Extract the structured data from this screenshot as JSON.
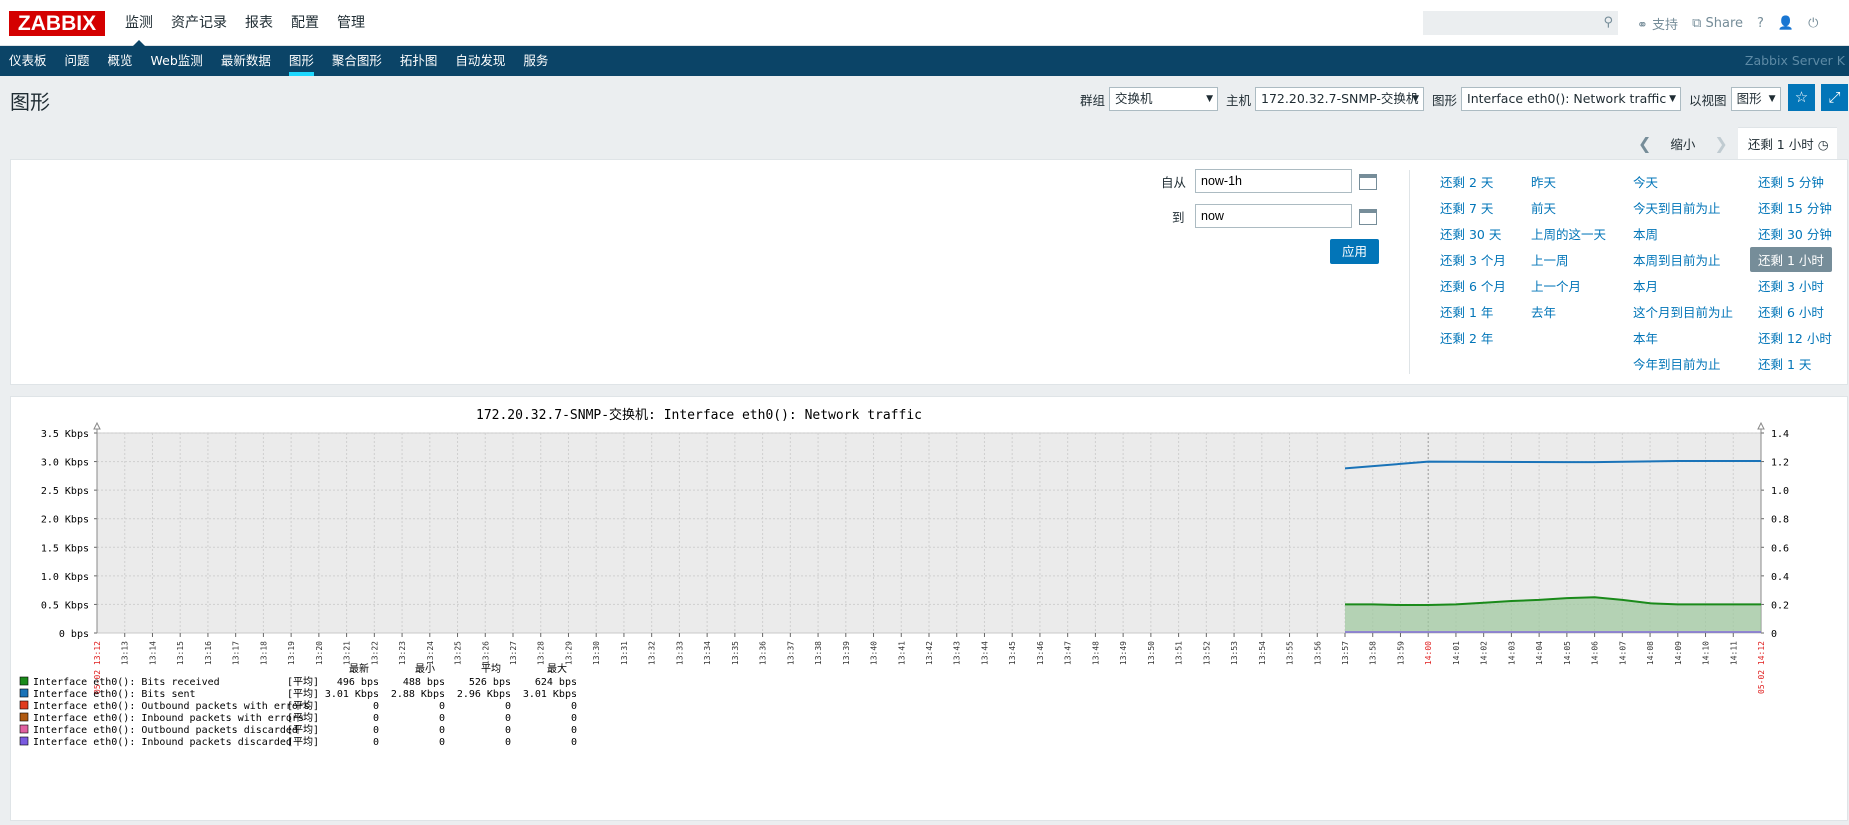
{
  "app": {
    "logo": "ZABBIX",
    "server_name": "Zabbix Server K"
  },
  "main_menu": [
    "监测",
    "资产记录",
    "报表",
    "配置",
    "管理"
  ],
  "top_links": {
    "support": "支持",
    "share": "Share",
    "help": "?",
    "user": "",
    "logout": ""
  },
  "search": {
    "placeholder": "",
    "value": ""
  },
  "sub_menu": [
    "仪表板",
    "问题",
    "概览",
    "Web监测",
    "最新数据",
    "图形",
    "聚合图形",
    "拓扑图",
    "自动发现",
    "服务"
  ],
  "page": {
    "title": "图形"
  },
  "filters": {
    "group_label": "群组",
    "group_value": "交换机",
    "host_label": "主机",
    "host_value": "172.20.32.7-SNMP-交换机",
    "graph_label": "图形",
    "graph_value": "Interface eth0(): Network traffic",
    "view_label": "以视图",
    "view_value": "图形"
  },
  "time_tabs": {
    "zoom_out": "缩小",
    "current": "还剩 1 小时"
  },
  "time_panel": {
    "from_label": "自从",
    "from_value": "now-1h",
    "to_label": "到",
    "to_value": "now",
    "apply": "应用",
    "quick": [
      [
        "还剩 2 天",
        "还剩 7 天",
        "还剩 30 天",
        "还剩 3 个月",
        "还剩 6 个月",
        "还剩 1 年",
        "还剩 2 年"
      ],
      [
        "昨天",
        "前天",
        "上周的这一天",
        "上一周",
        "上一个月",
        "去年"
      ],
      [
        "今天",
        "今天到目前为止",
        "本周",
        "本周到目前为止",
        "本月",
        "这个月到目前为止",
        "本年",
        "今年到目前为止"
      ],
      [
        "还剩 5 分钟",
        "还剩 15 分钟",
        "还剩 30 分钟",
        "还剩 1 小时",
        "还剩 3 小时",
        "还剩 6 小时",
        "还剩 12 小时",
        "还剩 1 天"
      ]
    ],
    "active_quick": "还剩 1 小时"
  },
  "chart_data": {
    "type": "area",
    "title": "172.20.32.7-SNMP-交换机: Interface eth0(): Network traffic",
    "y_left_ticks": [
      "0 bps",
      "0.5 Kbps",
      "1.0 Kbps",
      "1.5 Kbps",
      "2.0 Kbps",
      "2.5 Kbps",
      "3.0 Kbps",
      "3.5 Kbps"
    ],
    "y_left_lim": [
      0,
      3.5
    ],
    "y_right_ticks": [
      "0",
      "0.2",
      "0.4",
      "0.6",
      "0.8",
      "1.0",
      "1.2",
      "1.4"
    ],
    "y_right_lim": [
      0,
      1.4
    ],
    "x_start_label": "05-02 13:12",
    "x_end_label": "05-02 14:12",
    "x_minor_labels": [
      "13:13",
      "13:14",
      "13:15",
      "13:16",
      "13:17",
      "13:18",
      "13:19",
      "13:20",
      "13:21",
      "13:22",
      "13:23",
      "13:24",
      "13:25",
      "13:26",
      "13:27",
      "13:28",
      "13:29",
      "13:30",
      "13:31",
      "13:32",
      "13:33",
      "13:34",
      "13:35",
      "13:36",
      "13:37",
      "13:38",
      "13:39",
      "13:40",
      "13:41",
      "13:42",
      "13:43",
      "13:44",
      "13:45",
      "13:46",
      "13:47",
      "13:48",
      "13:49",
      "13:50",
      "13:51",
      "13:52",
      "13:53",
      "13:54",
      "13:55",
      "13:56",
      "13:57",
      "13:58",
      "13:59",
      "14:00",
      "14:01",
      "14:02",
      "14:03",
      "14:04",
      "14:05",
      "14:06",
      "14:07",
      "14:08",
      "14:09",
      "14:10",
      "14:11"
    ],
    "x_major": "14:00",
    "series": [
      {
        "name": "Interface eth0(): Bits received",
        "color": "#1a8a1a",
        "style": "area",
        "x_min": [
          57,
          58,
          59,
          60,
          61,
          62,
          63,
          64,
          65,
          66,
          67,
          68,
          69,
          70,
          71,
          72
        ],
        "kbps": [
          0.5,
          0.5,
          0.49,
          0.49,
          0.5,
          0.53,
          0.56,
          0.58,
          0.61,
          0.624,
          0.58,
          0.52,
          0.5,
          0.5,
          0.5,
          0.5
        ]
      },
      {
        "name": "Interface eth0(): Bits sent",
        "color": "#1a73b8",
        "style": "line",
        "x_min": [
          57,
          60,
          65,
          66,
          69,
          72
        ],
        "kbps": [
          2.88,
          3.0,
          2.99,
          2.99,
          3.01,
          3.01
        ]
      }
    ],
    "legend": {
      "headers": [
        "最新",
        "最小",
        "平均",
        "最大"
      ],
      "func": "[平均]",
      "rows": [
        {
          "name": "Interface eth0(): Bits received",
          "color": "#1a8a1a",
          "values": [
            "496 bps",
            "488 bps",
            "526 bps",
            "624 bps"
          ]
        },
        {
          "name": "Interface eth0(): Bits sent",
          "color": "#1a73b8",
          "values": [
            "3.01 Kbps",
            "2.88 Kbps",
            "2.96 Kbps",
            "3.01 Kbps"
          ]
        },
        {
          "name": "Interface eth0(): Outbound packets with errors",
          "color": "#e03c1f",
          "values": [
            "0",
            "0",
            "0",
            "0"
          ]
        },
        {
          "name": "Interface eth0(): Inbound packets with errors",
          "color": "#b05a12",
          "values": [
            "0",
            "0",
            "0",
            "0"
          ]
        },
        {
          "name": "Interface eth0(): Outbound packets discarded",
          "color": "#e060a0",
          "values": [
            "0",
            "0",
            "0",
            "0"
          ]
        },
        {
          "name": "Interface eth0(): Inbound packets discarded",
          "color": "#7a5ae0",
          "values": [
            "0",
            "0",
            "0",
            "0"
          ]
        }
      ]
    }
  }
}
